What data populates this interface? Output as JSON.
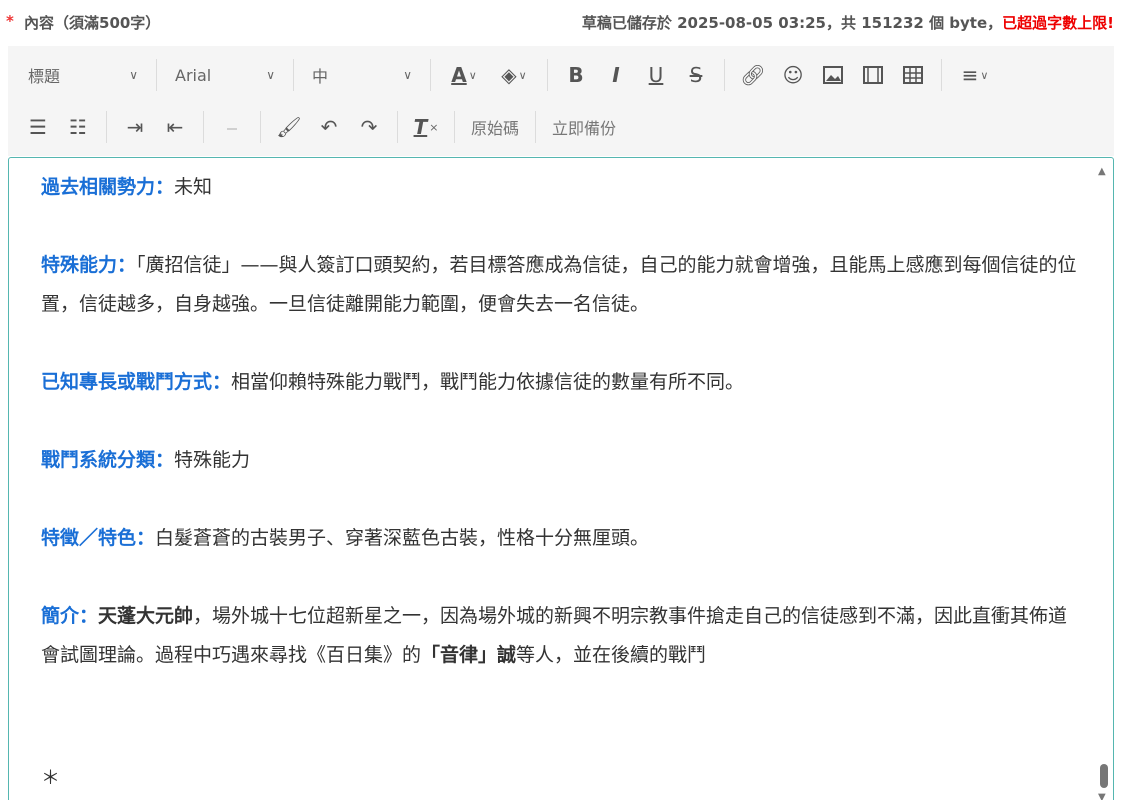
{
  "header": {
    "required_star": "*",
    "field_label": "內容（須滿500字）",
    "status_prefix": "草稿已儲存於 2025-08-05 03:25，共 151232 個 byte，",
    "status_warning": "已超過字數上限!"
  },
  "toolbar": {
    "format_select": "標題",
    "font_select": "Arial",
    "size_select": "中",
    "source_label": "原始碼",
    "backup_label": "立即備份"
  },
  "content": {
    "p1_key": "過去相關勢力：",
    "p1_val": "未知",
    "p2_key": "特殊能力：",
    "p2_val": "「廣招信徒」——與人簽訂口頭契約，若目標答應成為信徒，自己的能力就會增強，且能馬上感應到每個信徒的位置，信徒越多，自身越強。一旦信徒離開能力範圍，便會失去一名信徒。",
    "p3_key": "已知專長或戰鬥方式：",
    "p3_val": "相當仰賴特殊能力戰鬥，戰鬥能力依據信徒的數量有所不同。",
    "p4_key": "戰鬥系統分類：",
    "p4_val": "特殊能力",
    "p5_key": "特徵／特色：",
    "p5_val": "白髮蒼蒼的古裝男子、穿著深藍色古裝，性格十分無厘頭。",
    "p6_key": "簡介：",
    "p6_name": "天蓬大元帥",
    "p6_text1": "，場外城十七位超新星之一，因為場外城的新興不明宗教事件搶走自己的信徒感到不滿，因此直衝其佈道會試圖理論。過程中巧遇來尋找《百日集》的",
    "p6_bold2": "「音律」誠",
    "p6_text2": "等人，並在後續的戰鬥",
    "p7": "＊"
  },
  "colors": {
    "accent": "#1a6fd6",
    "warning": "#e00000",
    "editor_border": "#55b6b0",
    "toolbar_bg": "#f5f5f5"
  }
}
